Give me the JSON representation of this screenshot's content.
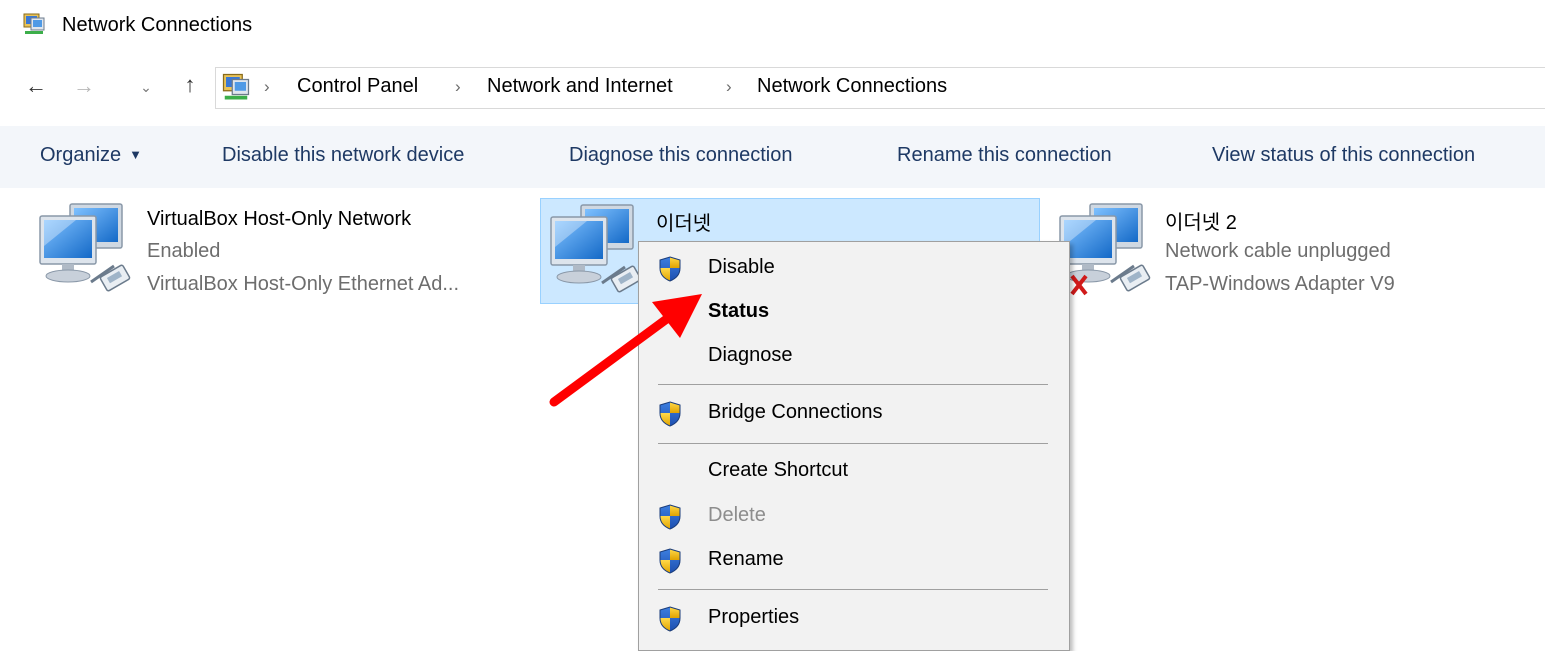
{
  "window": {
    "title": "Network Connections",
    "icon": "network-connections-icon"
  },
  "nav": {
    "back_icon": "arrow-left-icon",
    "forward_icon": "arrow-right-icon",
    "recent_icon": "chevron-down-icon",
    "up_icon": "arrow-up-icon",
    "back_glyph": "←",
    "forward_glyph": "→",
    "recent_glyph": "⌄",
    "up_glyph": "↑"
  },
  "address": {
    "icon": "network-connections-icon",
    "separator": "›",
    "crumbs": [
      "Control Panel",
      "Network and Internet",
      "Network Connections"
    ]
  },
  "toolbar": {
    "organize": "Organize",
    "organize_caret": "▼",
    "disable": "Disable this network device",
    "diagnose": "Diagnose this connection",
    "rename": "Rename this connection",
    "view_status": "View status of this connection"
  },
  "connections": [
    {
      "name": "VirtualBox Host-Only Network",
      "status": "Enabled",
      "device": "VirtualBox Host-Only Ethernet Ad...",
      "icon": "network-adapter-icon"
    },
    {
      "name": "이더넷",
      "status": "",
      "device": "",
      "icon": "network-adapter-icon",
      "selected": true
    },
    {
      "name": "이더넷 2",
      "status": "Network cable unplugged",
      "device": "TAP-Windows Adapter V9",
      "icon": "network-adapter-disconnected-icon"
    }
  ],
  "context_menu": {
    "items": [
      {
        "label": "Disable",
        "shield": true
      },
      {
        "label": "Status",
        "bold": true
      },
      {
        "label": "Diagnose"
      },
      {
        "label": "Bridge Connections",
        "shield": true
      },
      {
        "label": "Create Shortcut"
      },
      {
        "label": "Delete",
        "shield": true,
        "disabled": true
      },
      {
        "label": "Rename",
        "shield": true
      },
      {
        "label": "Properties",
        "shield": true
      }
    ]
  },
  "annotation": {
    "arrow_color": "#ff0000",
    "points_to": "Status"
  },
  "colors": {
    "toolbar_bg": "#f3f6fa",
    "toolbar_text": "#1e3964",
    "selection_bg": "#cce8ff",
    "selection_border": "#99d1ff",
    "menu_bg": "#f2f2f2"
  }
}
